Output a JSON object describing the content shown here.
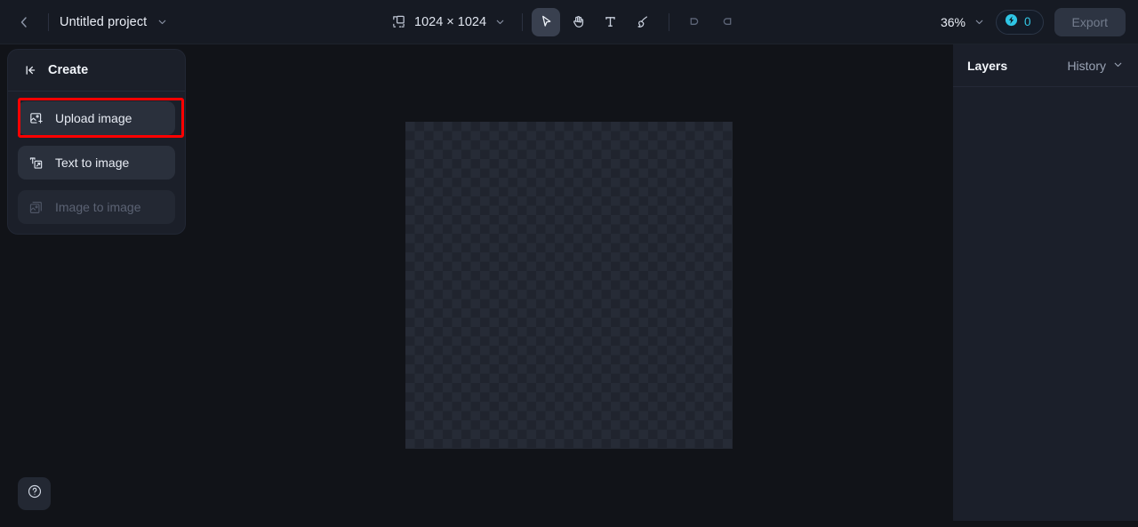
{
  "header": {
    "back_icon": "chevron-left-icon",
    "project_title": "Untitled project",
    "project_dropdown_icon": "chevron-down-icon",
    "canvas_size_icon": "canvas-size-icon",
    "canvas_size": "1024 × 1024",
    "canvas_size_dropdown_icon": "chevron-down-icon",
    "tools": [
      {
        "name": "select-tool",
        "icon": "cursor-arrow-icon",
        "active": true
      },
      {
        "name": "hand-tool",
        "icon": "hand-icon",
        "active": false
      },
      {
        "name": "text-tool",
        "icon": "text-t-icon",
        "active": false
      },
      {
        "name": "brush-tool",
        "icon": "paintbrush-icon",
        "active": false
      }
    ],
    "undo_icon": "undo-arrow-icon",
    "redo_icon": "redo-arrow-icon",
    "zoom_level": "36%",
    "zoom_dropdown_icon": "chevron-down-icon",
    "credits_icon": "credit-token-icon",
    "credits_count": "0",
    "credits_color": "#33c9e8",
    "export_label": "Export"
  },
  "create_panel": {
    "collapse_icon": "collapse-panel-icon",
    "title": "Create",
    "items": [
      {
        "label": "Upload image",
        "icon": "image-upload-icon",
        "disabled": false,
        "highlighted": true
      },
      {
        "label": "Text to image",
        "icon": "text-to-image-icon",
        "disabled": false,
        "highlighted": false
      },
      {
        "label": "Image to image",
        "icon": "image-to-image-icon",
        "disabled": true,
        "highlighted": false
      }
    ],
    "highlight_color": "#ff0000"
  },
  "help": {
    "icon": "help-question-icon"
  },
  "right_panel": {
    "layers_tab": "Layers",
    "history_tab": "History",
    "history_dropdown_icon": "chevron-down-icon"
  },
  "canvas": {
    "transparency_checker": "transparent-canvas"
  }
}
